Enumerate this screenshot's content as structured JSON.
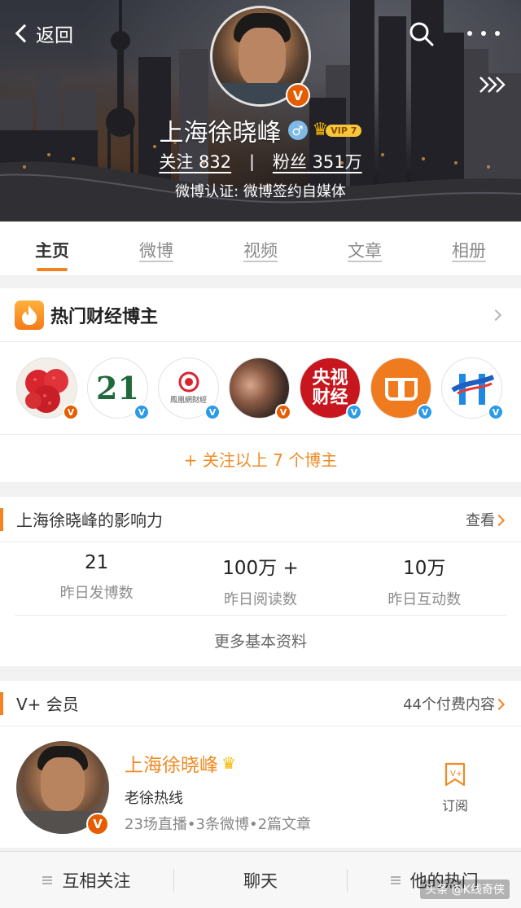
{
  "header": {
    "back_label": "返回",
    "user_name": "上海徐晓峰",
    "vip_level": "VIP 7",
    "following_label": "关注",
    "following_count": "832",
    "followers_label": "粉丝",
    "followers_count": "351万",
    "verification": "微博认证: 微博签约自媒体",
    "gender_symbol": "♂"
  },
  "tabs": [
    {
      "label": "主页",
      "active": true
    },
    {
      "label": "微博"
    },
    {
      "label": "视频"
    },
    {
      "label": "文章"
    },
    {
      "label": "相册"
    }
  ],
  "hot_bloggers": {
    "title": "热门财经博主",
    "avatars": [
      {
        "icon": "lychee-avatar",
        "badge": "orange-v"
      },
      {
        "icon": "21-avatar",
        "text": "21",
        "badge": "blue-v"
      },
      {
        "icon": "ifeng-finance-avatar",
        "text": "鳳凰網財經",
        "badge": "blue-v"
      },
      {
        "icon": "couple-avatar",
        "badge": "orange-v"
      },
      {
        "icon": "cctv-finance-avatar",
        "text": "央视财经",
        "badge": "blue-v"
      },
      {
        "icon": "orange-logo-avatar",
        "badge": "blue-v"
      },
      {
        "icon": "blue-logo-avatar",
        "badge": "blue-v"
      }
    ],
    "follow_all": "+ 关注以上 7 个博主"
  },
  "influence": {
    "title": "上海徐晓峰的影响力",
    "view_label": "查看",
    "metrics": [
      {
        "value": "21",
        "label": "昨日发博数"
      },
      {
        "value": "100万 +",
        "label": "昨日阅读数"
      },
      {
        "value": "10万",
        "label": "昨日互动数"
      }
    ],
    "more_label": "更多基本资料"
  },
  "vplus": {
    "title": "V+ 会员",
    "paid_content": "44个付费内容",
    "name": "上海徐晓峰",
    "subtitle": "老徐热线",
    "stats": "23场直播•3条微博•2篇文章",
    "subscribe_label": "订阅"
  },
  "bottom_bar": {
    "follow_each_other": "互相关注",
    "chat": "聊天",
    "his_hot": "他的热门"
  },
  "watermark": "头条 @K线奇侠",
  "colors": {
    "accent": "#f58220",
    "badge_orange": "#e65c00",
    "badge_blue": "#2b9be8"
  }
}
